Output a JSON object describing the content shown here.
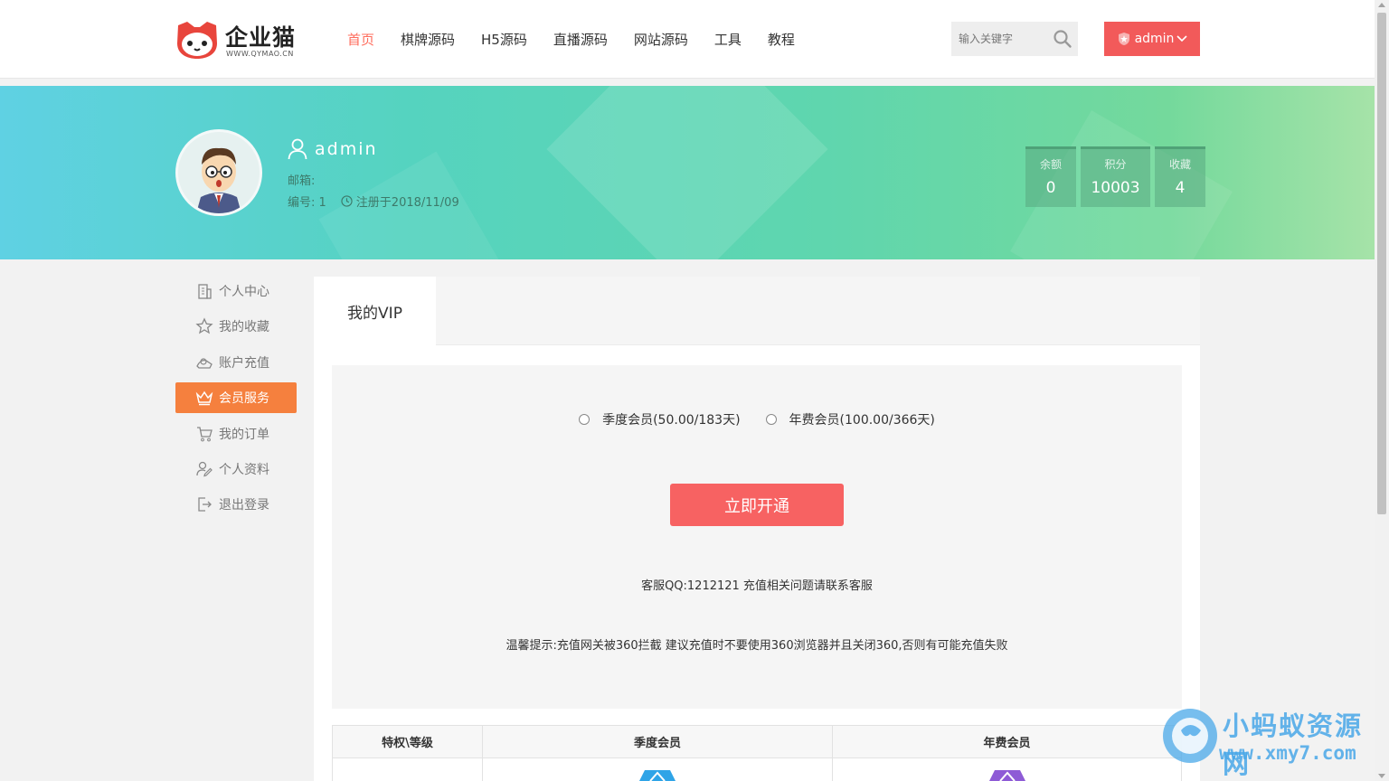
{
  "header": {
    "logo_text": "企业猫",
    "logo_sub": "WWW.QYMAO.CN",
    "nav": [
      {
        "label": "首页",
        "active": true
      },
      {
        "label": "棋牌源码",
        "active": false
      },
      {
        "label": "H5源码",
        "active": false
      },
      {
        "label": "直播源码",
        "active": false
      },
      {
        "label": "网站源码",
        "active": false
      },
      {
        "label": "工具",
        "active": false
      },
      {
        "label": "教程",
        "active": false
      }
    ],
    "search_placeholder": "输入关键字",
    "user_button": "admin"
  },
  "profile": {
    "username": "admin",
    "email_label": "邮箱:",
    "id_label": "编号: 1",
    "registered": "注册于2018/11/09",
    "stats": [
      {
        "label": "余额",
        "value": "0"
      },
      {
        "label": "积分",
        "value": "10003"
      },
      {
        "label": "收藏",
        "value": "4"
      }
    ]
  },
  "sidebar": {
    "items": [
      {
        "label": "个人中心",
        "icon": "building-icon",
        "active": false
      },
      {
        "label": "我的收藏",
        "icon": "star-icon",
        "active": false
      },
      {
        "label": "账户充值",
        "icon": "wallet-icon",
        "active": false
      },
      {
        "label": "会员服务",
        "icon": "crown-icon",
        "active": true
      },
      {
        "label": "我的订单",
        "icon": "cart-icon",
        "active": false
      },
      {
        "label": "个人资料",
        "icon": "user-edit-icon",
        "active": false
      },
      {
        "label": "退出登录",
        "icon": "logout-icon",
        "active": false
      }
    ]
  },
  "vip": {
    "tab_label": "我的VIP",
    "options": [
      {
        "label": "季度会员(50.00/183天)",
        "checked": false
      },
      {
        "label": "年费会员(100.00/366天)",
        "checked": false
      }
    ],
    "open_button": "立即开通",
    "service": "客服QQ:1212121 充值相关问题请联系客服",
    "tip": "温馨提示:充值网关被360拦截 建议充值时不要使用360浏览器并且关闭360,否则有可能充值失败",
    "table_headers": [
      "特权\\等级",
      "季度会员",
      "年费会员"
    ]
  },
  "watermark": {
    "text": "小蚂蚁资源网",
    "url": "www.xmy7.com"
  },
  "colors": {
    "accent_red": "#f25a5a",
    "nav_active": "#ff6c5c",
    "sidebar_active": "#f5803e"
  }
}
